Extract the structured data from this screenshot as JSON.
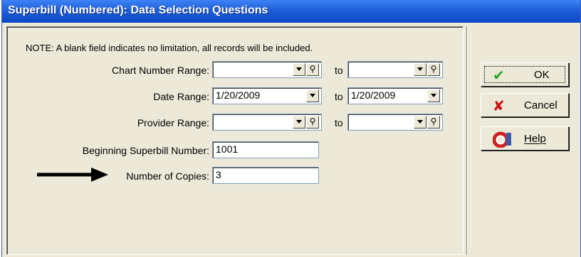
{
  "window": {
    "title": "Superbill (Numbered): Data Selection Questions"
  },
  "note": "NOTE: A blank field indicates no limitation,  all records will be included.",
  "to_label": "to",
  "chart_number_range": {
    "label": "Chart Number Range:",
    "from": "",
    "to": ""
  },
  "date_range": {
    "label": "Date Range:",
    "from": "1/20/2009",
    "to": "1/20/2009"
  },
  "provider_range": {
    "label": "Provider Range:",
    "from": "",
    "to": ""
  },
  "beginning_superbill": {
    "label": "Beginning Superbill Number:",
    "value": "1001"
  },
  "number_of_copies": {
    "label": "Number of Copies:",
    "value": "3"
  },
  "buttons": {
    "ok": "OK",
    "cancel": "Cancel",
    "help": "Help"
  },
  "icons": {
    "ok": "checkmark-icon",
    "cancel": "x-icon",
    "help": "lifebuoy-help-icon",
    "lookup": "magnifier-icon",
    "dropdown": "chevron-down-icon",
    "pointer": "arrow-right-icon"
  },
  "colors": {
    "title_bar": "#1f5fd8",
    "window_bg": "#ece9d8",
    "ok_check": "#2aa52a",
    "cancel_x": "#cc1111"
  }
}
